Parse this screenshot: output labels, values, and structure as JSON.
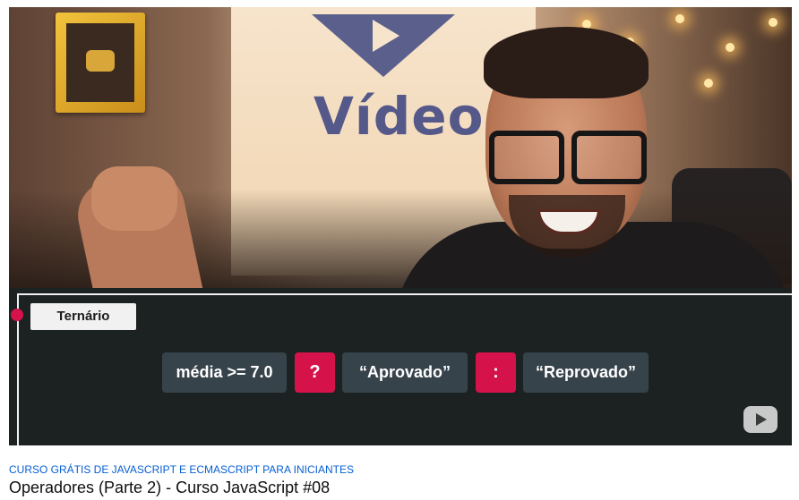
{
  "thumbnail": {
    "logo_text": "Vídeo",
    "panel": {
      "tag": "Ternário",
      "tokens": [
        {
          "text": "média >= 7.0",
          "kind": "expr"
        },
        {
          "text": "?",
          "kind": "operator"
        },
        {
          "text": "“Aprovado”",
          "kind": "expr"
        },
        {
          "text": ":",
          "kind": "operator"
        },
        {
          "text": "“Reprovado”",
          "kind": "expr"
        }
      ]
    },
    "play_badge_icon": "play-icon"
  },
  "playlist_link": "CURSO GRÁTIS DE JAVASCRIPT E ECMASCRIPT PARA INICIANTES",
  "video_title": "Operadores (Parte 2) - Curso JavaScript #08",
  "colors": {
    "link": "#065fd4",
    "accent": "#d5124a",
    "token_bg": "#37434b",
    "panel_bg": "#1c2221"
  }
}
